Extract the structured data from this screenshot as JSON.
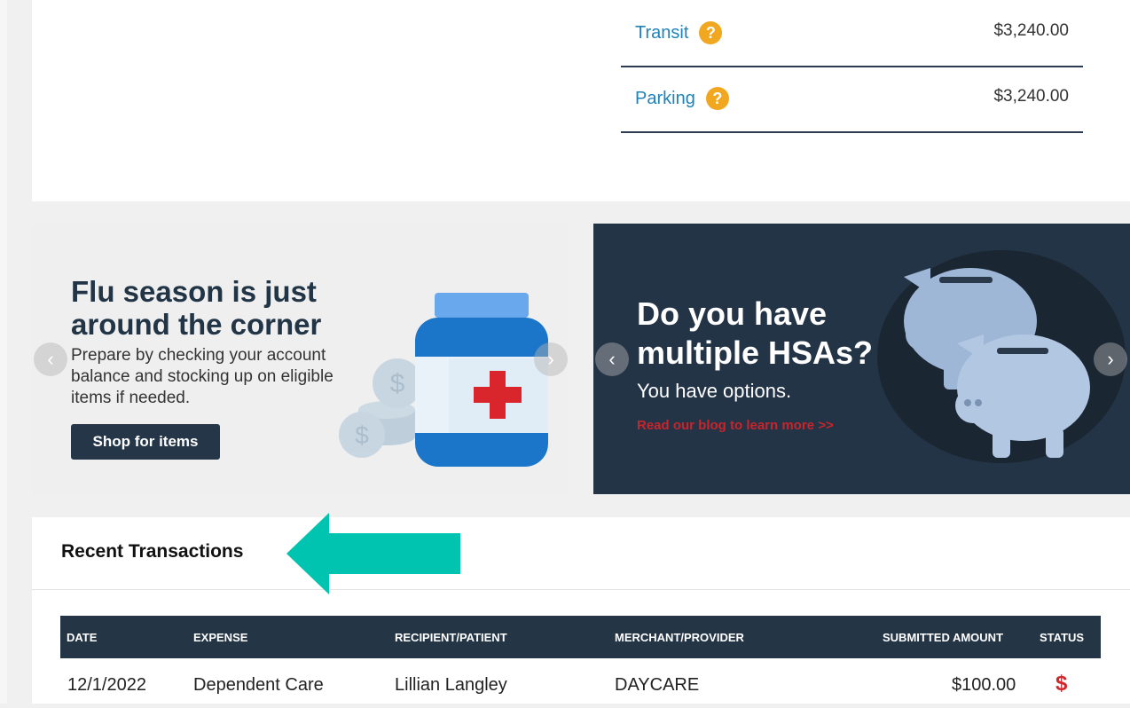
{
  "accounts": [
    {
      "name": "Transit",
      "amount": "$3,240.00"
    },
    {
      "name": "Parking",
      "amount": "$3,240.00"
    }
  ],
  "promo_left": {
    "title": "Flu season is just around the corner",
    "description": "Prepare by checking your account balance and stocking up on eligible items if needed.",
    "button": "Shop for items"
  },
  "promo_right": {
    "title": "Do you have multiple HSAs?",
    "subtitle": "You have options.",
    "link": "Read our blog to learn more >>"
  },
  "transactions": {
    "title": "Recent Transactions",
    "columns": [
      "DATE",
      "EXPENSE",
      "RECIPIENT/PATIENT",
      "MERCHANT/PROVIDER",
      "SUBMITTED AMOUNT",
      "STATUS"
    ],
    "rows": [
      {
        "date": "12/1/2022",
        "expense": "Dependent Care",
        "recipient": "Lillian Langley",
        "merchant": "DAYCARE",
        "amount": "$100.00",
        "status": "$"
      }
    ]
  },
  "colors": {
    "accent": "#1f82b8",
    "navy": "#243546",
    "help": "#f1a820",
    "arrow": "#00c4b0",
    "status": "#d0262c"
  }
}
